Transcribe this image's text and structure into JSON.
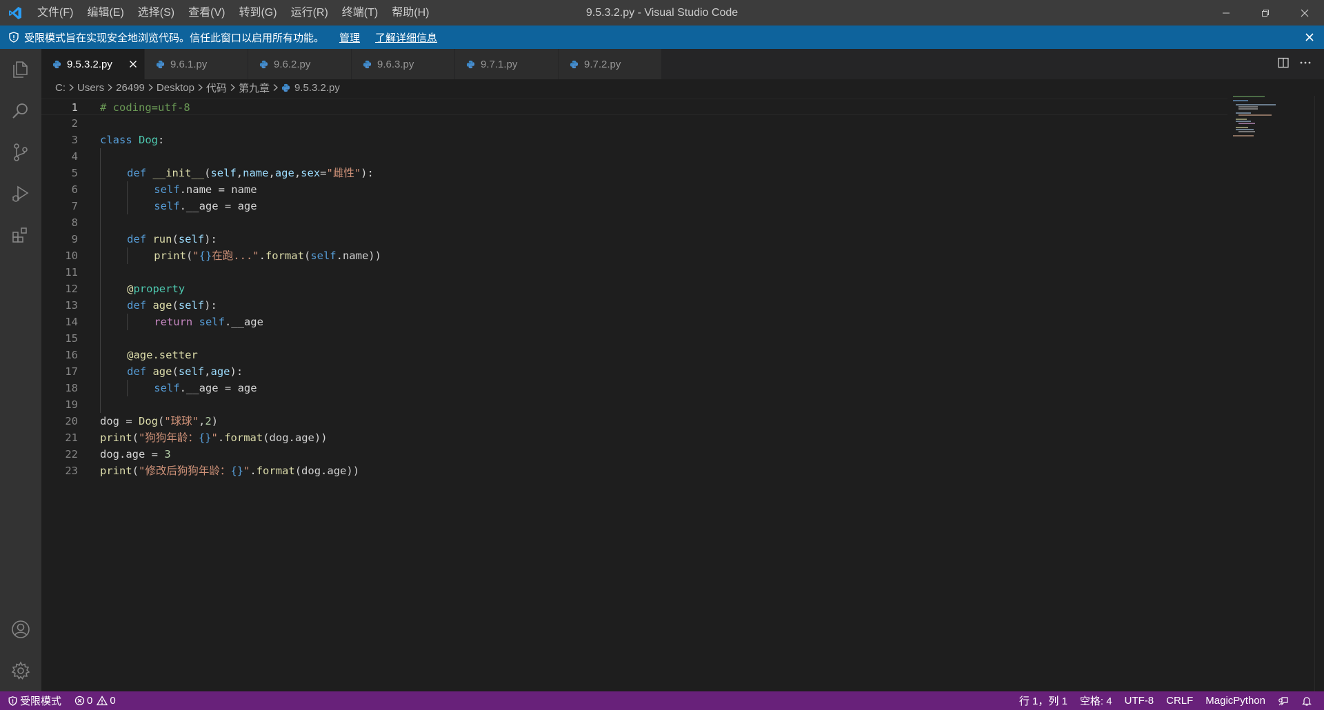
{
  "window": {
    "title": "9.5.3.2.py - Visual Studio Code",
    "menu": [
      "文件(F)",
      "编辑(E)",
      "选择(S)",
      "查看(V)",
      "转到(G)",
      "运行(R)",
      "终端(T)",
      "帮助(H)"
    ]
  },
  "banner": {
    "message": "受限模式旨在实现安全地浏览代码。信任此窗口以启用所有功能。",
    "manage": "管理",
    "learn_more": "了解详细信息"
  },
  "tabs": [
    {
      "label": "9.5.3.2.py",
      "active": true
    },
    {
      "label": "9.6.1.py",
      "active": false
    },
    {
      "label": "9.6.2.py",
      "active": false
    },
    {
      "label": "9.6.3.py",
      "active": false
    },
    {
      "label": "9.7.1.py",
      "active": false
    },
    {
      "label": "9.7.2.py",
      "active": false
    }
  ],
  "breadcrumb": [
    "C:",
    "Users",
    "26499",
    "Desktop",
    "代码",
    "第九章",
    "9.5.3.2.py"
  ],
  "editor": {
    "line_numbers": [
      "1",
      "2",
      "3",
      "4",
      "5",
      "6",
      "7",
      "8",
      "9",
      "10",
      "11",
      "12",
      "13",
      "14",
      "15",
      "16",
      "17",
      "18",
      "19",
      "20",
      "21",
      "22",
      "23"
    ],
    "current_line": 1,
    "lines": [
      {
        "indent": 0,
        "tokens": [
          [
            "c-comment",
            "# coding=utf-8"
          ]
        ]
      },
      {
        "indent": 0,
        "tokens": []
      },
      {
        "indent": 0,
        "tokens": [
          [
            "c-kw",
            "class"
          ],
          [
            "",
            " "
          ],
          [
            "c-cls",
            "Dog"
          ],
          [
            "",
            ":"
          ]
        ]
      },
      {
        "indent": 1,
        "tokens": []
      },
      {
        "indent": 1,
        "tokens": [
          [
            "c-kw",
            "def"
          ],
          [
            "",
            " "
          ],
          [
            "c-fn",
            "__init__"
          ],
          [
            "",
            "("
          ],
          [
            "c-param",
            "self"
          ],
          [
            "",
            ","
          ],
          [
            "c-param",
            "name"
          ],
          [
            "",
            ","
          ],
          [
            "c-param",
            "age"
          ],
          [
            "",
            ","
          ],
          [
            "c-param",
            "sex"
          ],
          [
            "",
            "="
          ],
          [
            "c-str",
            "\"雌性\""
          ],
          [
            "",
            "):"
          ]
        ]
      },
      {
        "indent": 2,
        "tokens": [
          [
            "c-self",
            "self"
          ],
          [
            "",
            ".name = name"
          ]
        ]
      },
      {
        "indent": 2,
        "tokens": [
          [
            "c-self",
            "self"
          ],
          [
            "",
            ".__age = age"
          ]
        ]
      },
      {
        "indent": 1,
        "tokens": []
      },
      {
        "indent": 1,
        "tokens": [
          [
            "c-kw",
            "def"
          ],
          [
            "",
            " "
          ],
          [
            "c-fn",
            "run"
          ],
          [
            "",
            "("
          ],
          [
            "c-param",
            "self"
          ],
          [
            "",
            "):"
          ]
        ]
      },
      {
        "indent": 2,
        "tokens": [
          [
            "c-fn",
            "print"
          ],
          [
            "",
            "("
          ],
          [
            "c-str",
            "\""
          ],
          [
            "c-kw",
            "{}"
          ],
          [
            "c-str",
            "在跑...\""
          ],
          [
            "",
            "."
          ],
          [
            "c-fn",
            "format"
          ],
          [
            "",
            "("
          ],
          [
            "c-self",
            "self"
          ],
          [
            "",
            ".name))"
          ]
        ]
      },
      {
        "indent": 1,
        "tokens": []
      },
      {
        "indent": 1,
        "tokens": [
          [
            "c-fn",
            "@"
          ],
          [
            "c-cls",
            "property"
          ]
        ]
      },
      {
        "indent": 1,
        "tokens": [
          [
            "c-kw",
            "def"
          ],
          [
            "",
            " "
          ],
          [
            "c-fn",
            "age"
          ],
          [
            "",
            "("
          ],
          [
            "c-param",
            "self"
          ],
          [
            "",
            "):"
          ]
        ]
      },
      {
        "indent": 2,
        "tokens": [
          [
            "c-ctrl",
            "return"
          ],
          [
            "",
            " "
          ],
          [
            "c-self",
            "self"
          ],
          [
            "",
            ".__age"
          ]
        ]
      },
      {
        "indent": 1,
        "tokens": []
      },
      {
        "indent": 1,
        "tokens": [
          [
            "c-fn",
            "@age.setter"
          ]
        ]
      },
      {
        "indent": 1,
        "tokens": [
          [
            "c-kw",
            "def"
          ],
          [
            "",
            " "
          ],
          [
            "c-fn",
            "age"
          ],
          [
            "",
            "("
          ],
          [
            "c-param",
            "self"
          ],
          [
            "",
            ","
          ],
          [
            "c-param",
            "age"
          ],
          [
            "",
            "):"
          ]
        ]
      },
      {
        "indent": 2,
        "tokens": [
          [
            "c-self",
            "self"
          ],
          [
            "",
            ".__age = age"
          ]
        ]
      },
      {
        "indent": 0,
        "tokens": []
      },
      {
        "indent": 0,
        "tokens": [
          [
            "",
            "dog = "
          ],
          [
            "c-fn",
            "Dog"
          ],
          [
            "",
            "("
          ],
          [
            "c-str",
            "\"球球\""
          ],
          [
            "",
            ","
          ],
          [
            "c-num",
            "2"
          ],
          [
            "",
            ")"
          ]
        ]
      },
      {
        "indent": 0,
        "tokens": [
          [
            "c-fn",
            "print"
          ],
          [
            "",
            "("
          ],
          [
            "c-str",
            "\"狗狗年龄："
          ],
          [
            "c-kw",
            "{}"
          ],
          [
            "c-str",
            "\""
          ],
          [
            "",
            "."
          ],
          [
            "c-fn",
            "format"
          ],
          [
            "",
            "(dog.age))"
          ]
        ]
      },
      {
        "indent": 0,
        "tokens": [
          [
            "",
            "dog.age = "
          ],
          [
            "c-num",
            "3"
          ]
        ]
      },
      {
        "indent": 0,
        "tokens": [
          [
            "c-fn",
            "print"
          ],
          [
            "",
            "("
          ],
          [
            "c-str",
            "\"修改后狗狗年龄："
          ],
          [
            "c-kw",
            "{}"
          ],
          [
            "c-str",
            "\""
          ],
          [
            "",
            "."
          ],
          [
            "c-fn",
            "format"
          ],
          [
            "",
            "(dog.age))"
          ]
        ]
      }
    ]
  },
  "statusbar": {
    "restricted": "受限模式",
    "errors": "0",
    "warnings": "0",
    "position": "行 1，列 1",
    "spaces": "空格: 4",
    "encoding": "UTF-8",
    "eol": "CRLF",
    "language": "MagicPython"
  },
  "colors": {
    "banner": "#0e639c",
    "statusbar": "#68217a",
    "activitybar": "#333333",
    "editor": "#1e1e1e"
  }
}
